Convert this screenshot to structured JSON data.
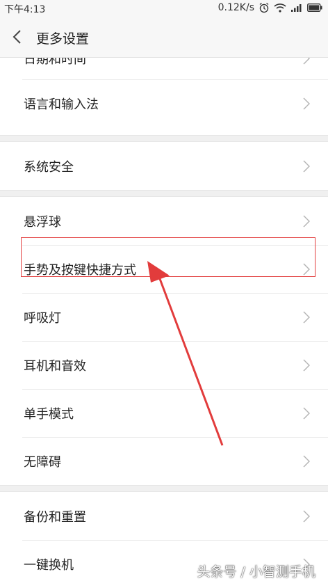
{
  "status_bar": {
    "time": "下午4:13",
    "network_speed": "0.12K/s",
    "icons": [
      "alarm-icon",
      "wifi-icon",
      "signal-icon",
      "battery-icon"
    ]
  },
  "header": {
    "title": "更多设置",
    "back_icon": "chevron-left-icon"
  },
  "groups": [
    {
      "items": [
        {
          "label": "日期和时间"
        },
        {
          "label": "语言和输入法"
        }
      ]
    },
    {
      "items": [
        {
          "label": "系统安全"
        }
      ]
    },
    {
      "items": [
        {
          "label": "悬浮球"
        },
        {
          "label": "手势及按键快捷方式"
        },
        {
          "label": "呼吸灯"
        },
        {
          "label": "耳机和音效"
        },
        {
          "label": "单手模式"
        },
        {
          "label": "无障碍"
        }
      ]
    },
    {
      "items": [
        {
          "label": "备份和重置"
        },
        {
          "label": "一键换机"
        }
      ]
    }
  ],
  "annotation": {
    "highlight_target": "手势及按键快捷方式",
    "color": "#e23c3c"
  },
  "watermark": "头条号 / 小智测手机"
}
